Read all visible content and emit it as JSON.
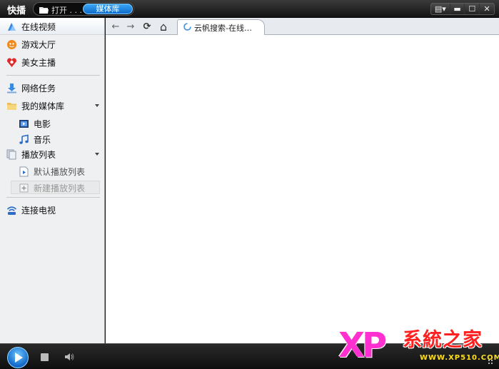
{
  "app": {
    "title": "快播"
  },
  "header": {
    "open_label": "打开 . . .",
    "media_tab_label": "媒体库",
    "window_buttons": {
      "menu": "▤▾",
      "minimize": "▬",
      "maximize": "☐",
      "close": "✕"
    }
  },
  "sidebar": {
    "items": [
      {
        "label": "在线视频",
        "icon": "online-video-icon"
      },
      {
        "label": "游戏大厅",
        "icon": "game-hall-icon"
      },
      {
        "label": "美女主播",
        "icon": "live-host-icon"
      },
      {
        "label": "网络任务",
        "icon": "download-icon"
      },
      {
        "label": "我的媒体库",
        "icon": "folder-icon"
      },
      {
        "label": "电影",
        "icon": "movie-icon"
      },
      {
        "label": "音乐",
        "icon": "music-icon"
      },
      {
        "label": "播放列表",
        "icon": "playlist-icon"
      },
      {
        "label": "默认播放列表",
        "icon": "default-playlist-icon"
      },
      {
        "label": "新建播放列表",
        "icon": "add-playlist-icon"
      },
      {
        "label": "连接电视",
        "icon": "wifi-tv-icon"
      }
    ]
  },
  "browser": {
    "tab_title": "云帆搜索-在线…",
    "nav": {
      "back": "←",
      "forward": "→",
      "refresh": "⟳",
      "home": "⌂"
    }
  },
  "watermark": {
    "brand": "XP",
    "text": "系統之家",
    "url": "WWW.XP510.COM"
  },
  "colors": {
    "accent": "#1a7fe0",
    "sidebar_bg": "#eef0f2",
    "titlebar": "#1f1f1f"
  }
}
